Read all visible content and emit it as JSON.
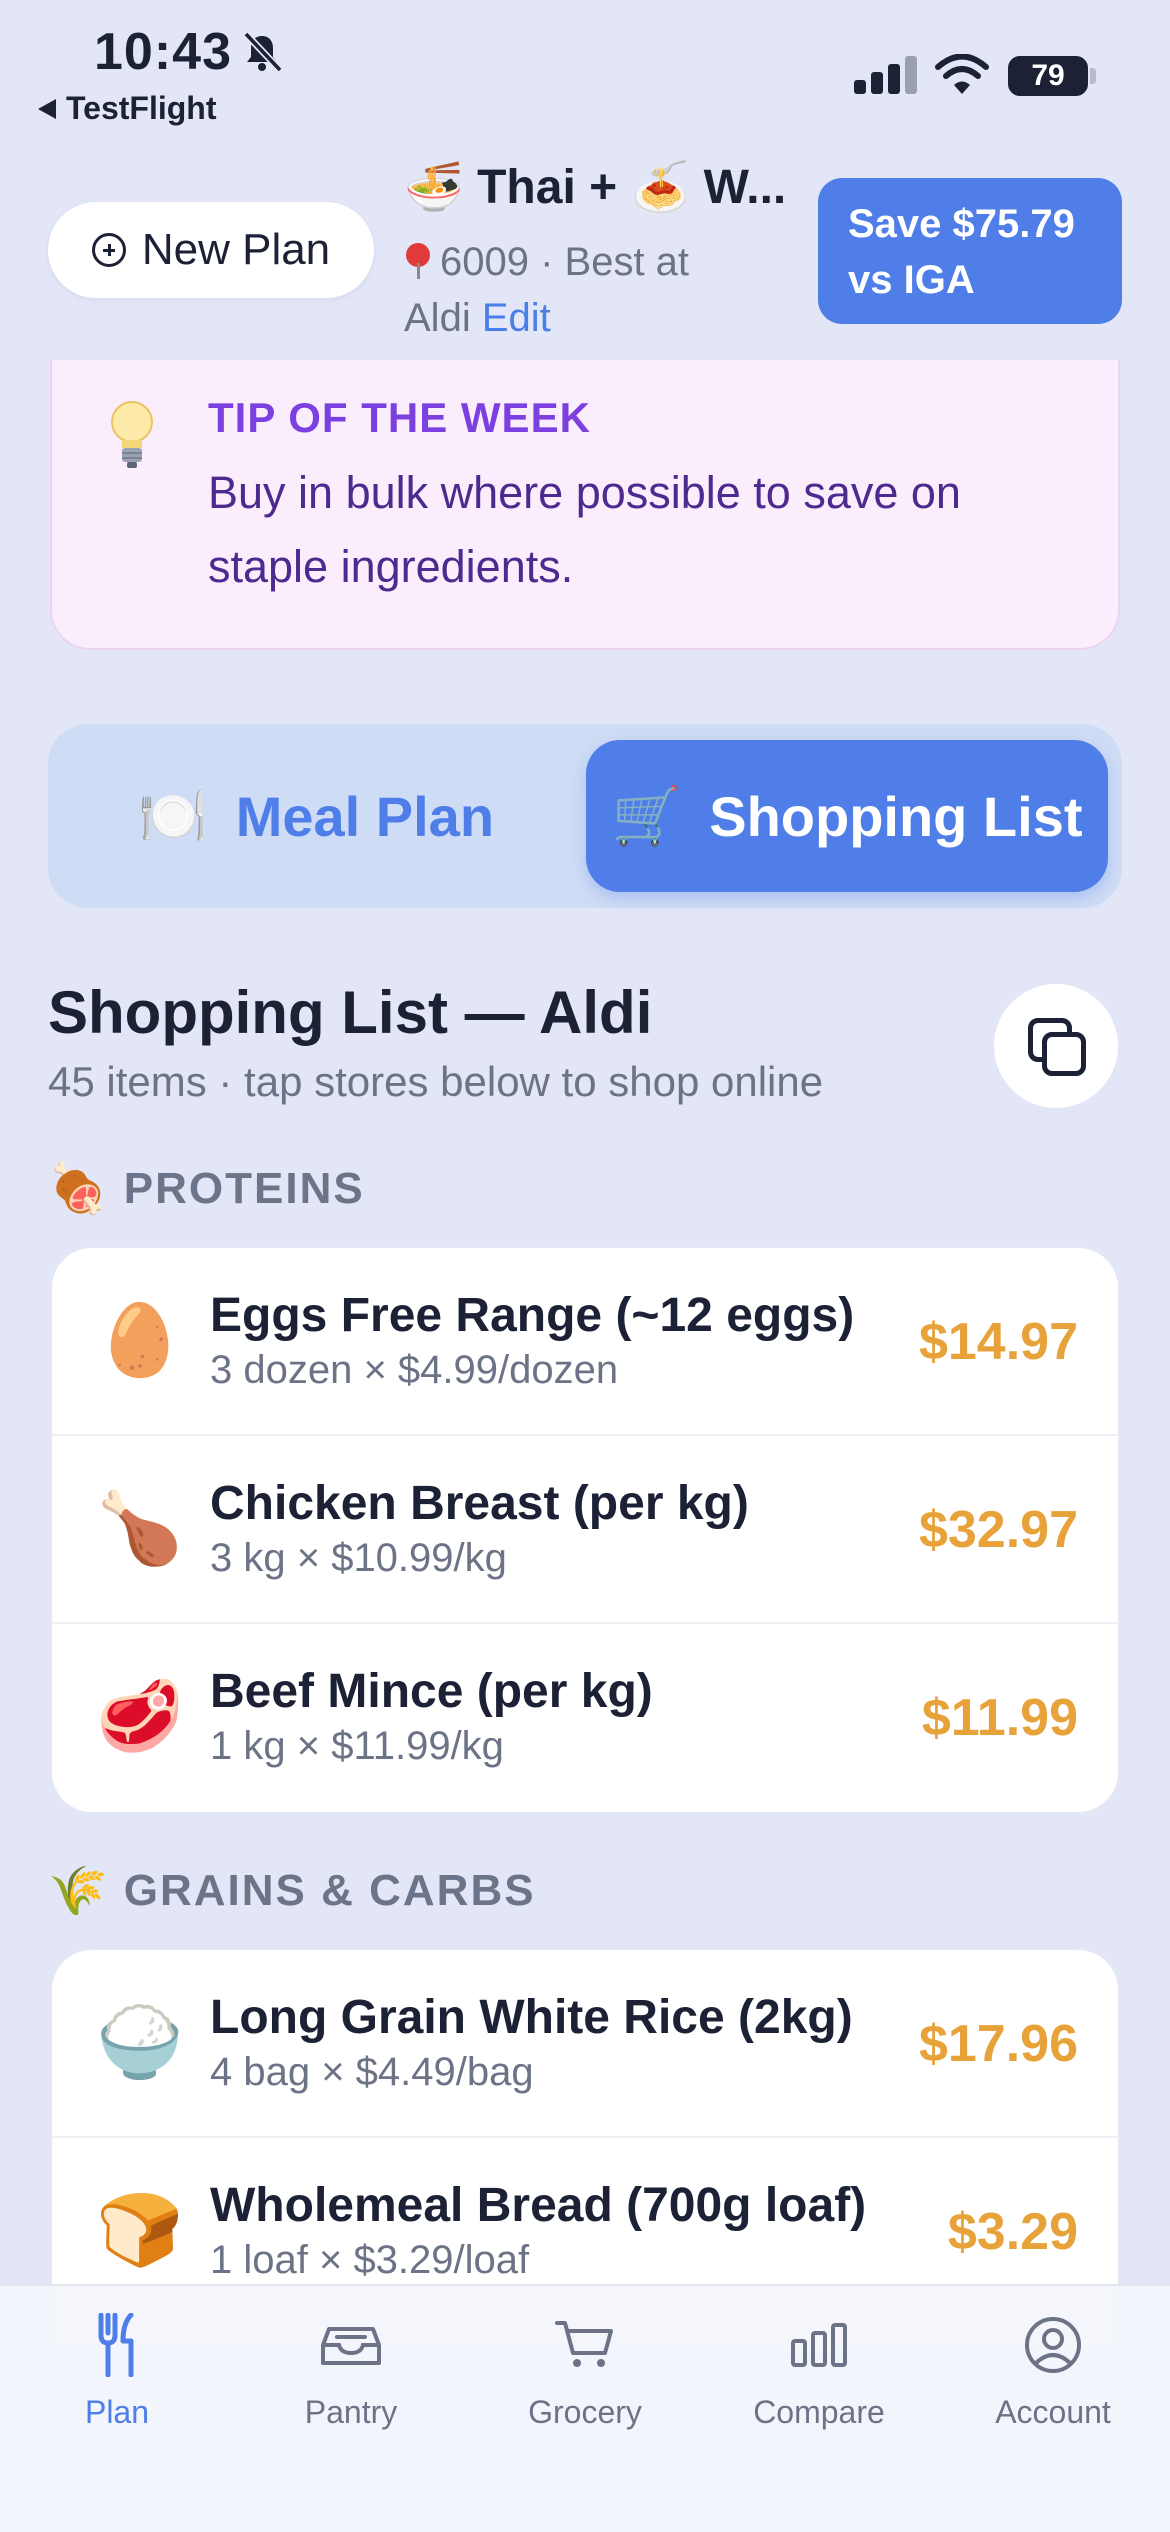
{
  "status_bar": {
    "time": "10:43",
    "back_app": "TestFlight",
    "battery": "79"
  },
  "header": {
    "new_plan_label": "New Plan",
    "plan_title": "🍜 Thai + 🍝 W...",
    "postcode_line": "6009 · Best at",
    "store_line": "Aldi",
    "edit_label": "Edit",
    "save_badge": "Save $75.79 vs IGA"
  },
  "tip": {
    "heading": "TIP OF THE WEEK",
    "text": "Buy in bulk where possible to save on staple ingredients."
  },
  "tabs": [
    {
      "icon": "🍽️",
      "label": "Meal Plan",
      "active": false
    },
    {
      "icon": "🛒",
      "label": "Shopping List",
      "active": true
    }
  ],
  "shopping_list": {
    "title": "Shopping List — Aldi",
    "subtitle": "45 items · tap stores below to shop online"
  },
  "categories": [
    {
      "emoji": "🍖",
      "name": "PROTEINS",
      "items": [
        {
          "emoji": "🥚",
          "name": "Eggs Free Range (~12 eggs)",
          "qty": "3 dozen × $4.99/dozen",
          "price": "$14.97"
        },
        {
          "emoji": "🍗",
          "name": "Chicken Breast (per kg)",
          "qty": "3 kg × $10.99/kg",
          "price": "$32.97"
        },
        {
          "emoji": "🥩",
          "name": "Beef Mince (per kg)",
          "qty": "1 kg × $11.99/kg",
          "price": "$11.99"
        }
      ]
    },
    {
      "emoji": "🌾",
      "name": "GRAINS & CARBS",
      "items": [
        {
          "emoji": "🍚",
          "name": "Long Grain White Rice (2kg)",
          "qty": "4 bag × $4.49/bag",
          "price": "$17.96"
        },
        {
          "emoji": "🍞",
          "name": "Wholemeal Bread (700g loaf)",
          "qty": "1 loaf × $3.29/loaf",
          "price": "$3.29"
        }
      ]
    }
  ],
  "bottom_nav": [
    {
      "label": "Plan",
      "icon": "fork-knife-icon",
      "active": true
    },
    {
      "label": "Pantry",
      "icon": "inbox-icon",
      "active": false
    },
    {
      "label": "Grocery",
      "icon": "cart-icon",
      "active": false
    },
    {
      "label": "Compare",
      "icon": "bar-chart-icon",
      "active": false
    },
    {
      "label": "Account",
      "icon": "person-circle-icon",
      "active": false
    }
  ],
  "colors": {
    "background": "#e2e6f6",
    "accent": "#4f7ee8",
    "price": "#e8a23a",
    "tip_heading": "#7c3fe0",
    "tip_text": "#4c2a8f"
  }
}
